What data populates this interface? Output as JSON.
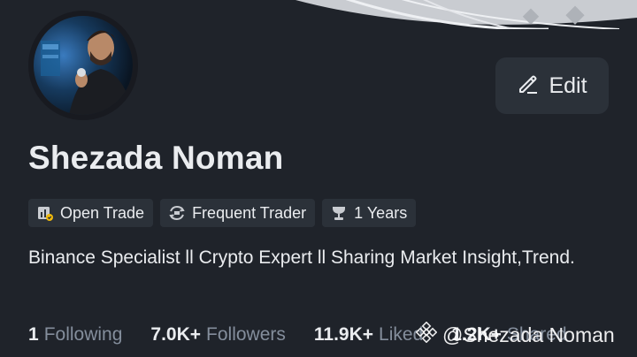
{
  "profile": {
    "name": "Shezada Noman",
    "bio": "Binance Specialist ll Crypto Expert ll Sharing Market Insight,Trend."
  },
  "tags": [
    {
      "label": "Open Trade",
      "icon": "open-trade-icon"
    },
    {
      "label": "Frequent Trader",
      "icon": "frequent-trader-icon"
    },
    {
      "label": "1 Years",
      "icon": "trophy-icon"
    }
  ],
  "edit_button": {
    "label": "Edit",
    "icon": "pencil-icon"
  },
  "stats": [
    {
      "value": "1",
      "label": "Following"
    },
    {
      "value": "7.0K+",
      "label": "Followers"
    },
    {
      "value": "11.9K+",
      "label": "Liked"
    },
    {
      "value": "1.2K+",
      "label": "Shared"
    }
  ],
  "watermark": {
    "text": "@Shezada Noman",
    "icon": "binance-logo-icon"
  },
  "colors": {
    "background": "#1f232a",
    "card": "#2b3139",
    "text": "#eaecef",
    "muted": "#848e9c"
  }
}
